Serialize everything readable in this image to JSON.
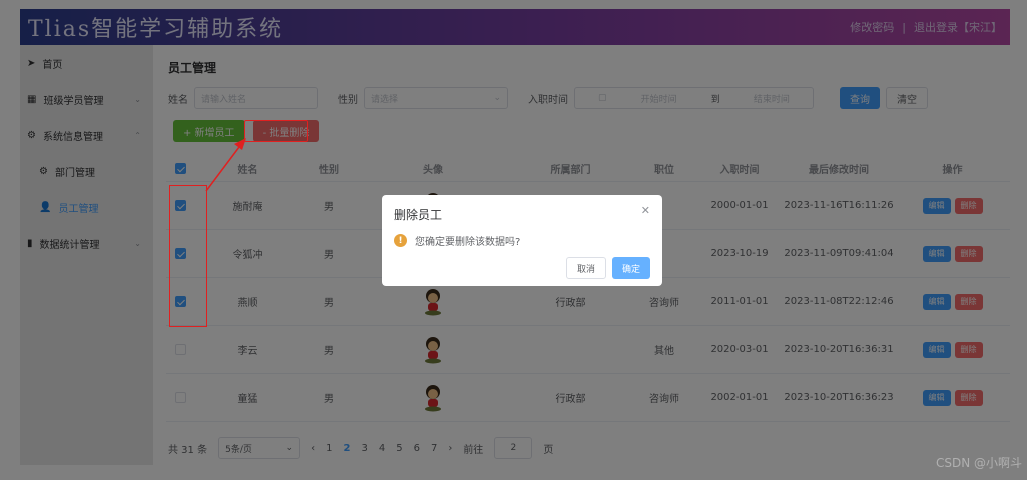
{
  "header": {
    "title": "Tlias智能学习辅助系统",
    "change_password": "修改密码",
    "separator": "|",
    "logout": "退出登录【宋江】"
  },
  "sidebar": {
    "items": [
      {
        "label": "首页",
        "icon": "send-icon"
      },
      {
        "label": "班级学员管理",
        "icon": "grid-icon"
      },
      {
        "label": "系统信息管理",
        "icon": "gear-icon"
      },
      {
        "label": "部门管理",
        "icon": "gear-icon"
      },
      {
        "label": "员工管理",
        "icon": "user-icon"
      },
      {
        "label": "数据统计管理",
        "icon": "bar-chart-icon"
      }
    ]
  },
  "main": {
    "title": "员工管理",
    "search": {
      "name_label": "姓名",
      "name_placeholder": "请输入姓名",
      "gender_label": "性别",
      "gender_placeholder": "请选择",
      "date_label": "入职时间",
      "date_start": "开始时间",
      "date_to": "到",
      "date_end": "结束时间",
      "query": "查询",
      "clear": "清空"
    },
    "actions": {
      "add": "+ 新增员工",
      "batch_delete": "- 批量删除"
    },
    "table": {
      "headers": [
        "",
        "姓名",
        "性别",
        "头像",
        "所属部门",
        "职位",
        "入职时间",
        "最后修改时间",
        "操作"
      ],
      "rows": [
        {
          "name": "施耐庵",
          "gender": "男",
          "dept": "",
          "pos": "",
          "entry": "2000-01-01",
          "updated": "2023-11-16T16:11:26",
          "checked": true
        },
        {
          "name": "令狐冲",
          "gender": "男",
          "dept": "",
          "pos": "",
          "entry": "2023-10-19",
          "updated": "2023-11-09T09:41:04",
          "checked": true
        },
        {
          "name": "燕顺",
          "gender": "男",
          "dept": "行政部",
          "pos": "咨询师",
          "entry": "2011-01-01",
          "updated": "2023-11-08T22:12:46",
          "checked": true
        },
        {
          "name": "李云",
          "gender": "男",
          "dept": "",
          "pos": "其他",
          "entry": "2020-03-01",
          "updated": "2023-10-20T16:36:31",
          "checked": false
        },
        {
          "name": "童猛",
          "gender": "男",
          "dept": "行政部",
          "pos": "咨询师",
          "entry": "2002-01-01",
          "updated": "2023-10-20T16:36:23",
          "checked": false
        }
      ],
      "edit": "编辑",
      "delete": "删除"
    },
    "pagination": {
      "total": "共 31 条",
      "size": "5条/页",
      "pages": [
        "1",
        "2",
        "3",
        "4",
        "5",
        "6",
        "7"
      ],
      "current": "2",
      "goto": "前往",
      "goto_value": "2",
      "page_unit": "页"
    }
  },
  "dialog": {
    "title": "删除员工",
    "message": "您确定要删除该数据吗?",
    "cancel": "取消",
    "confirm": "确定"
  },
  "watermark": "CSDN @小啊斗"
}
